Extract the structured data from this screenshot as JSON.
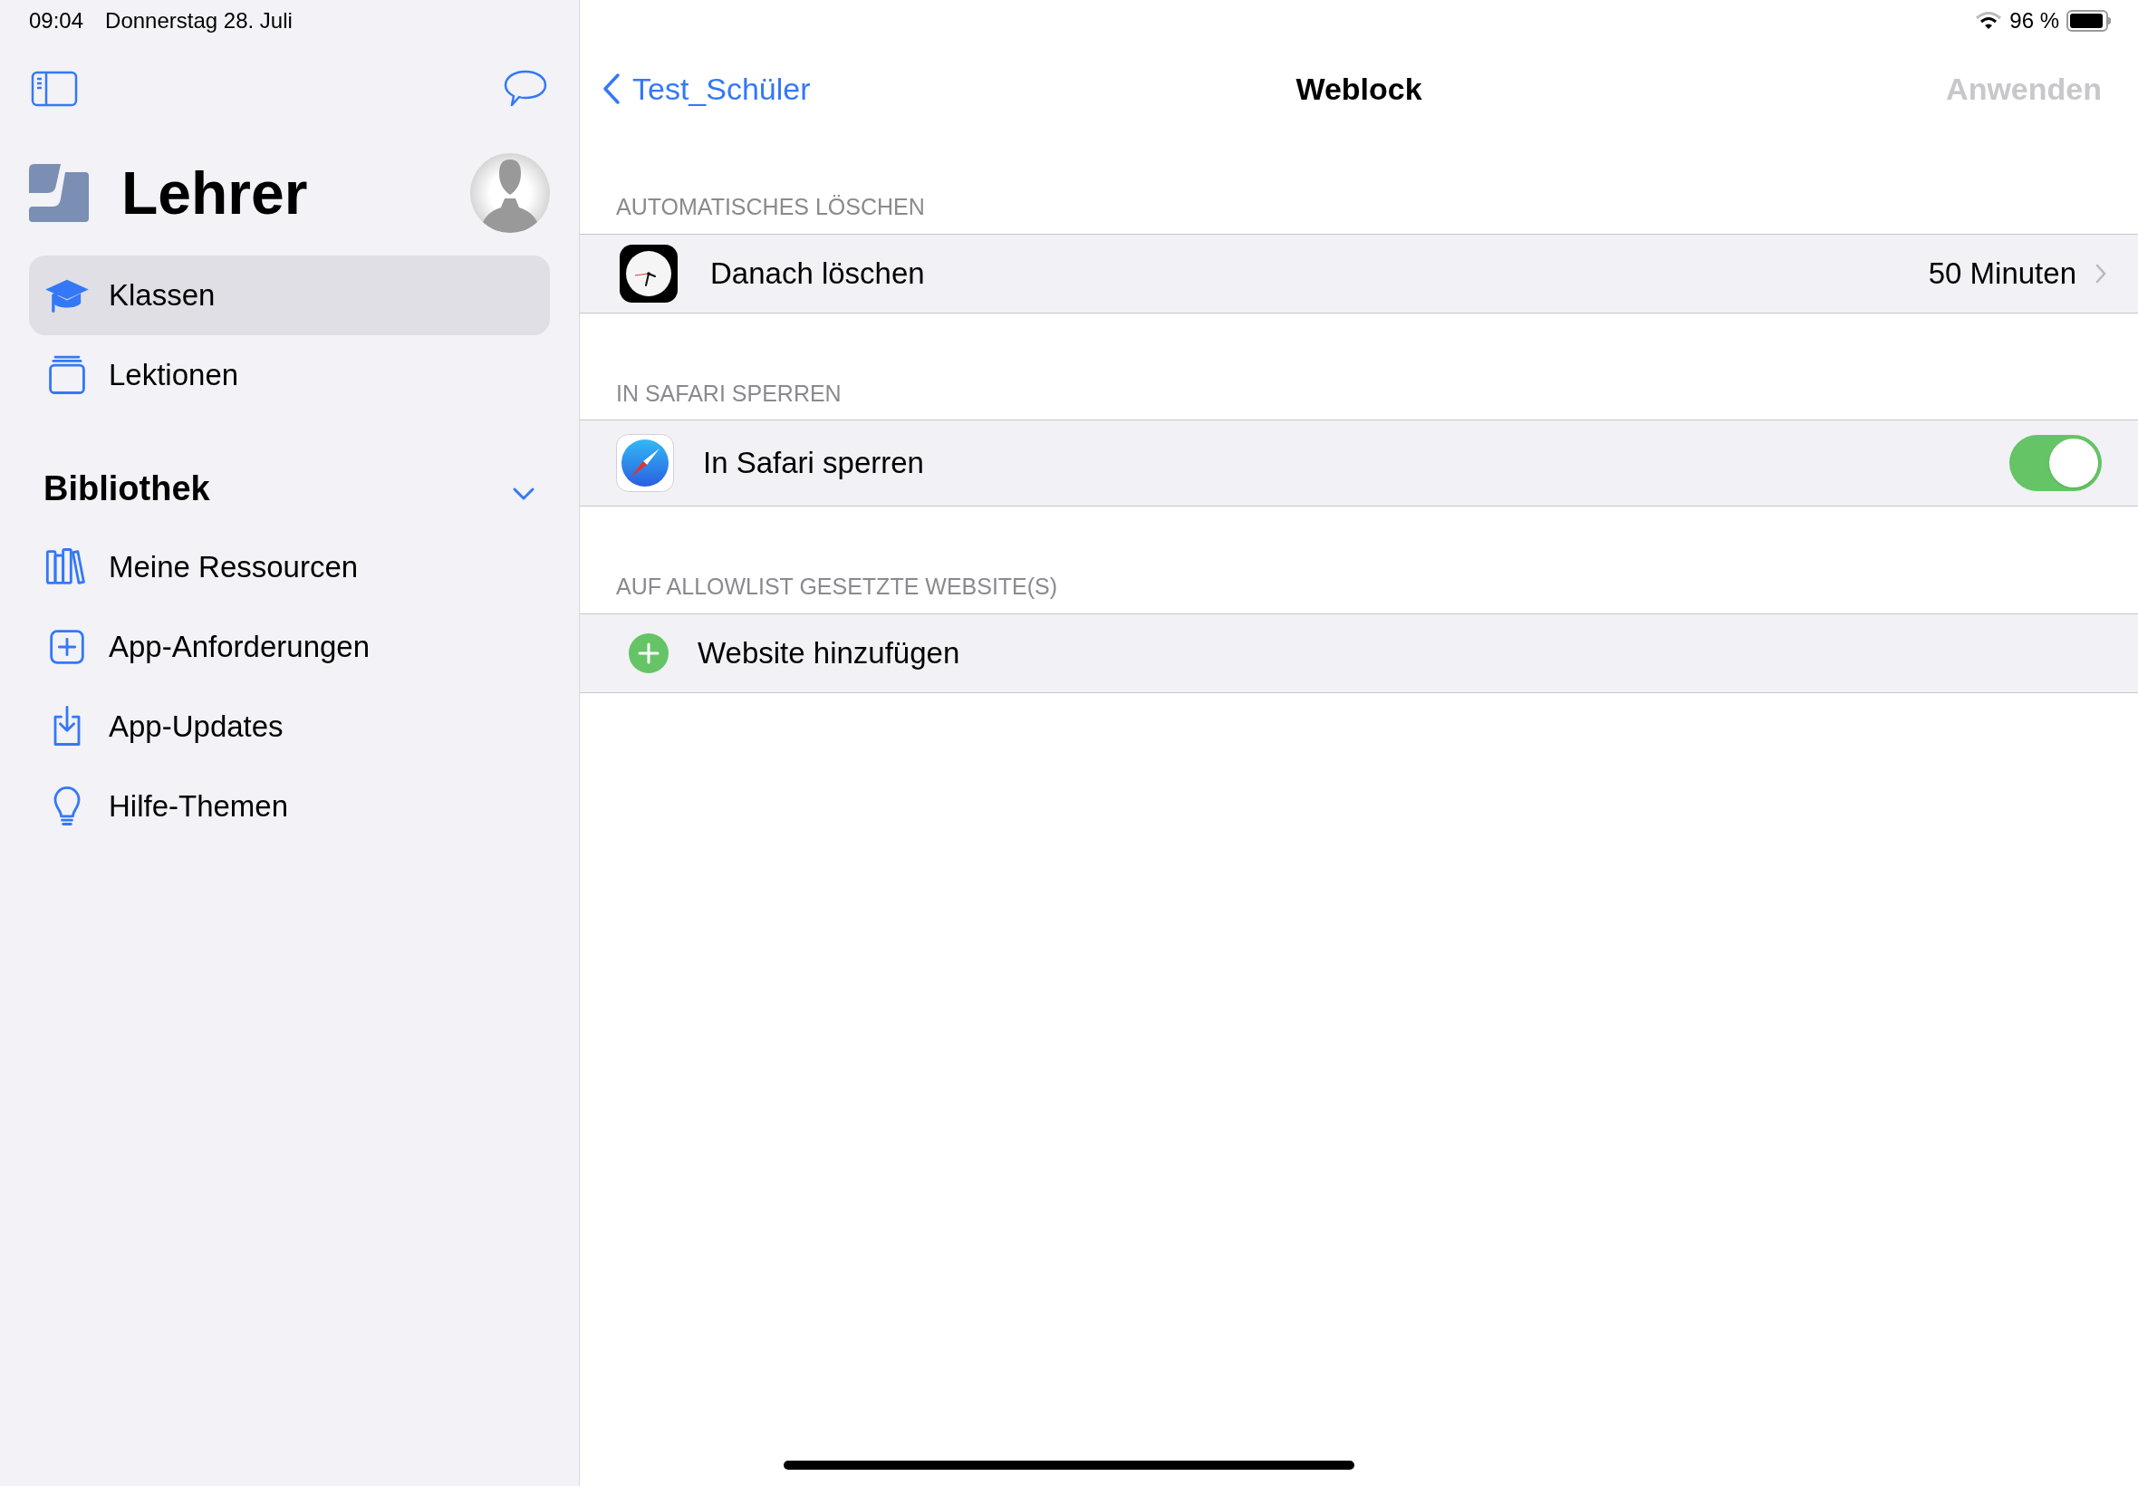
{
  "status_bar": {
    "time": "09:04",
    "date": "Donnerstag 28. Juli",
    "battery": "96 %"
  },
  "sidebar": {
    "title": "Lehrer",
    "items": [
      {
        "label": "Klassen",
        "selected": true
      },
      {
        "label": "Lektionen",
        "selected": false
      }
    ],
    "library": {
      "title": "Bibliothek",
      "expanded": true,
      "items": [
        {
          "label": "Meine Ressourcen",
          "selected": false
        },
        {
          "label": "App-Anforderungen",
          "selected": false
        },
        {
          "label": "App-Updates",
          "selected": false
        },
        {
          "label": "Hilfe-Themen",
          "selected": false
        }
      ]
    }
  },
  "nav": {
    "back": "Test_Schüler",
    "title": "Weblock",
    "action": "Anwenden",
    "action_disabled": true
  },
  "sections": [
    {
      "header": "AUTOMATISCHES LÖSCHEN",
      "rows": [
        {
          "kind": "value",
          "label": "Danach löschen",
          "value": "50 Minuten"
        }
      ]
    },
    {
      "header": "IN SAFARI SPERREN",
      "rows": [
        {
          "kind": "toggle",
          "label": "In Safari sperren",
          "on": true
        }
      ]
    },
    {
      "header": "AUF ALLOWLIST GESETZTE WEBSITE(S)",
      "rows": [
        {
          "kind": "add",
          "label": "Website hinzufügen"
        }
      ]
    }
  ]
}
